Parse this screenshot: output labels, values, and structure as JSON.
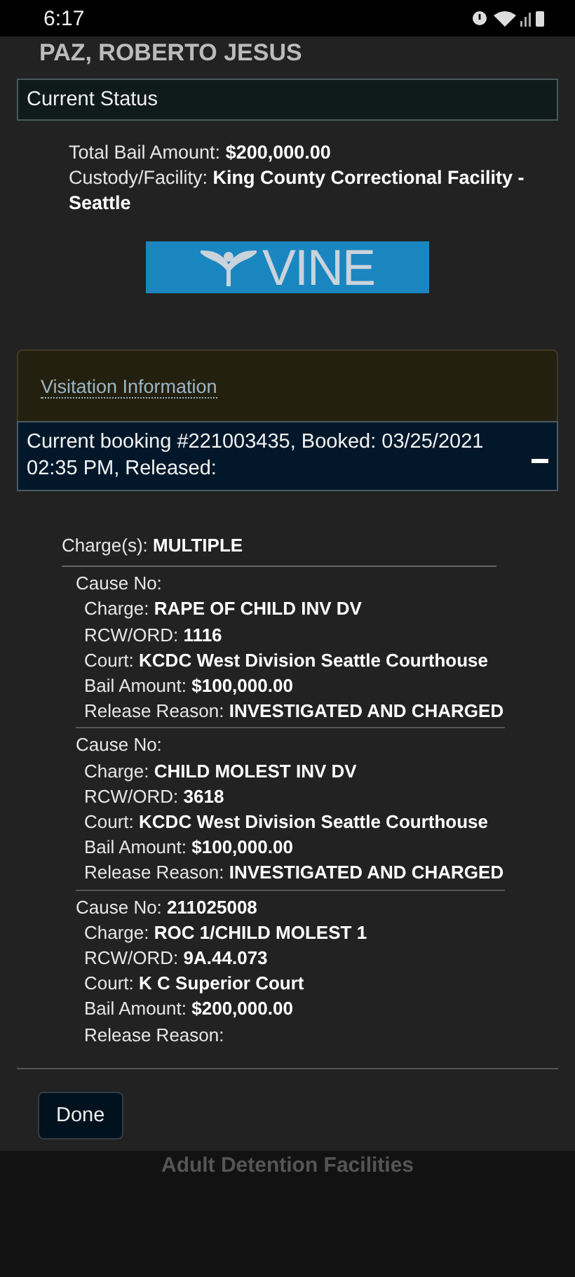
{
  "status_bar": {
    "time": "6:17"
  },
  "header": {
    "title": "PAZ, ROBERTO JESUS"
  },
  "current_status": {
    "title": "Current Status",
    "fields": [
      {
        "label": "Total Bail Amount:",
        "value": "$200,000.00"
      },
      {
        "label": "Custody/Facility:",
        "value": "King County Correctional Facility - Seattle"
      }
    ],
    "logo": {
      "text": "VINE"
    }
  },
  "visitation": {
    "link": "Visitation Information"
  },
  "booking": {
    "title": "Current booking #221003435, Booked: 03/25/2021 02:35 PM, Released:",
    "expanded": true
  },
  "charges": {
    "label": "Charge(s):",
    "value": "MULTIPLE",
    "causes": [
      {
        "fields": [
          {
            "label": "Cause No:"
          },
          {
            "label": "Charge:",
            "value": "RAPE OF CHILD INV DV"
          },
          {
            "label": "RCW/ORD:",
            "value": "1116"
          },
          {
            "label": "Court:",
            "value": "KCDC West Division Seattle Courthouse"
          },
          {
            "label": "Bail Amount:",
            "value": "$100,000.00"
          },
          {
            "label": "Release Reason:",
            "value": "INVESTIGATED AND CHARGED"
          }
        ]
      },
      {
        "fields": [
          {
            "label": "Cause No:"
          },
          {
            "label": "Charge:",
            "value": "CHILD MOLEST INV DV"
          },
          {
            "label": "RCW/ORD:",
            "value": "3618"
          },
          {
            "label": "Court:",
            "value": "KCDC West Division Seattle Courthouse"
          },
          {
            "label": "Bail Amount:",
            "value": "$100,000.00"
          },
          {
            "label": "Release Reason:",
            "value": "INVESTIGATED AND CHARGED"
          }
        ]
      },
      {
        "fields": [
          {
            "label": "Cause No:",
            "value": "211025008"
          },
          {
            "label": "Charge:",
            "value": "ROC 1/CHILD MOLEST 1"
          },
          {
            "label": "RCW/ORD:",
            "value": "9A.44.073"
          },
          {
            "label": "Court:",
            "value": "K C Superior Court"
          },
          {
            "label": "Bail Amount:",
            "value": "$200,000.00"
          },
          {
            "label": "Release Reason:"
          }
        ]
      }
    ]
  },
  "done_button": "Done",
  "page_behind": {
    "heading": "Adult Detention Facilities"
  }
}
